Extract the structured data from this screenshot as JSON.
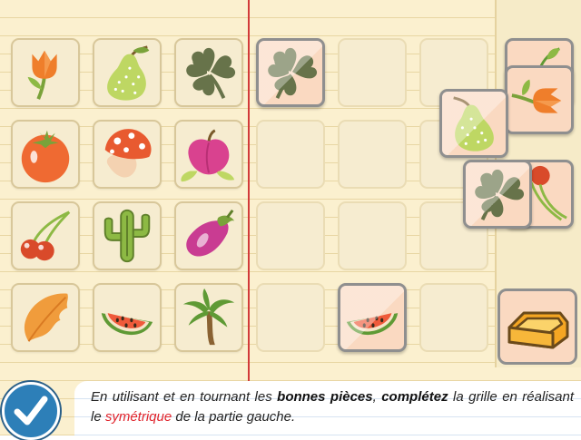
{
  "instruction": {
    "part1": "En utilisant et en tournant les ",
    "bold1": "bonnes pièces",
    "part2": ", ",
    "bold2": "complétez",
    "part3": " la grille en réalisant le ",
    "red": "symétrique",
    "part4": " de la partie gauche."
  },
  "colors": {
    "paper": "#fbf0cf",
    "margin_line": "#d23a3a",
    "piece_bg": "#fad9c1",
    "piece_border": "#8f8f8f",
    "check_button": "#2d7fb8",
    "highlight_text": "#e0242c"
  },
  "left_grid": [
    [
      "tulip-icon",
      "pear-icon",
      "clover-icon"
    ],
    [
      "tomato-icon",
      "mushroom-icon",
      "peach-icon"
    ],
    [
      "cherry-icon",
      "cactus-icon",
      "eggplant-icon"
    ],
    [
      "leaf-icon",
      "watermelon-icon",
      "palm-tree-icon"
    ]
  ],
  "right_grid_placed": [
    {
      "row": 0,
      "col": 0,
      "icon": "clover-icon"
    },
    {
      "row": 3,
      "col": 1,
      "icon": "watermelon-icon"
    }
  ],
  "piece_stack": [
    "tulip-icon",
    "pear-icon",
    "clover-icon",
    "cherry-icon"
  ],
  "icons": {
    "check": "checkmark-icon",
    "tray": "tray-icon"
  }
}
